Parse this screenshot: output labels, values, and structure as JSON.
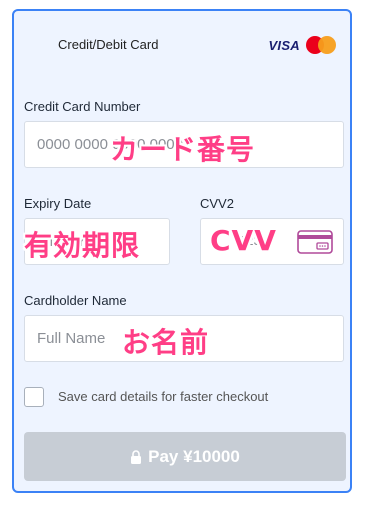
{
  "header": {
    "title": "Credit/Debit Card",
    "visa_label": "VISA"
  },
  "card_number": {
    "label": "Credit Card Number",
    "placeholder": "0000 0000 0000 0000",
    "overlay": "カード番号"
  },
  "expiry": {
    "label": "Expiry Date",
    "placeholder": "MM/YY",
    "overlay": "有効期限"
  },
  "cvv": {
    "label": "CVV2",
    "placeholder": "123",
    "overlay": "CVV"
  },
  "cardholder": {
    "label": "Cardholder Name",
    "placeholder": "Full Name",
    "overlay": "お名前"
  },
  "save_card": {
    "label": "Save card details for faster checkout",
    "checked": false
  },
  "pay_button": {
    "label": "Pay ¥10000"
  },
  "colors": {
    "border_accent": "#3b82f6",
    "panel_bg": "#eef4ff",
    "overlay_pink": "#ff3e86",
    "button_disabled": "#c7cdd5"
  },
  "icons": [
    "visa-logo",
    "mastercard-logo",
    "cvv-card-icon",
    "lock-icon"
  ]
}
